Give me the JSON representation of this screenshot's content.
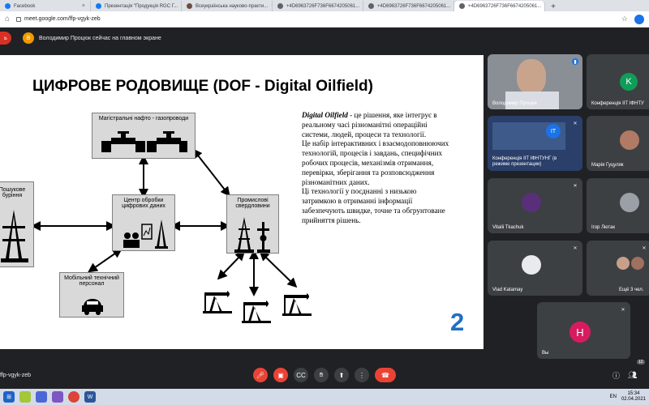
{
  "browser": {
    "tabs": [
      {
        "label": "Facebook",
        "color": "#1877f2"
      },
      {
        "label": "Презентація \"Продукція RGC Г...",
        "color": "#1877f2"
      },
      {
        "label": "Всеукраїнська науково-практи...",
        "color": "#6d4c41"
      },
      {
        "label": "+4D6963726F736F6674205061...",
        "color": "#5f6368"
      },
      {
        "label": "+4D6963726F736F6674205061...",
        "color": "#5f6368"
      },
      {
        "label": "+4D6963726F736F6674205061...",
        "color": "#5f6368",
        "active": true
      }
    ],
    "url": "meet.google.com/ffp-vgyk-zeb"
  },
  "meet": {
    "left_badge": "ь",
    "presenter_initial": "В",
    "presenter_text": "Володимир Процюк сейчас на главном экране",
    "meeting_code": "ffp-vgyk-zeb",
    "participants_count": "12"
  },
  "slide": {
    "title": "ЦИФРОВЕ РОДОВИЩЕ (DOF - Digital Oilfield)",
    "boxes": {
      "pipelines": "Магістральні нафто - газопроводи",
      "drilling": "Пошукове буріння",
      "center": "Центр обробки цифрових даних",
      "wells": "Промислові свердловини",
      "mobile": "Мобільний технічний персонал"
    },
    "para_lead": "Digital Oilfield",
    "para_rest": " - це рішення, яке інтегрує в реальному часі різноманітні операційні системи, людей, процеси та технології.",
    "para2": "Це набір інтерактивних і взаємодоповнюючих технологій, процесів і завдань, специфічних робочих процесів, механізмів отримання, перевірки, зберігання та розповсюдження різноманітних даних.",
    "para3": "Ці технології у поєднанні з низькою затримкою в отриманні інформації забезпечують швидке, точне та обгрунтоване прийняття рішень.",
    "page_number": "2"
  },
  "participants": [
    {
      "name": "Володимир Процюк",
      "type": "video"
    },
    {
      "name": "Конференція ІІТ ІФНТУ",
      "initial": "K",
      "color": "#0f9d58"
    },
    {
      "name": "Конференція ІІТ ІФНТУНГ (в режиме презентации)",
      "type": "presentation"
    },
    {
      "name": "Марія Гуцуляк",
      "type": "photo"
    },
    {
      "name": "Vitalii Tkachuk",
      "type": "photo"
    },
    {
      "name": "Ігор Лютак",
      "type": "photo"
    },
    {
      "name": "Vlad Katamay",
      "type": "photo"
    },
    {
      "name": "Ещё 3 чел.",
      "type": "more"
    },
    {
      "name": "Вы",
      "initial": "Н",
      "color": "#d81b60"
    }
  ],
  "taskbar": {
    "lang": "EN",
    "time": "15:34",
    "date": "02.04.2021"
  }
}
